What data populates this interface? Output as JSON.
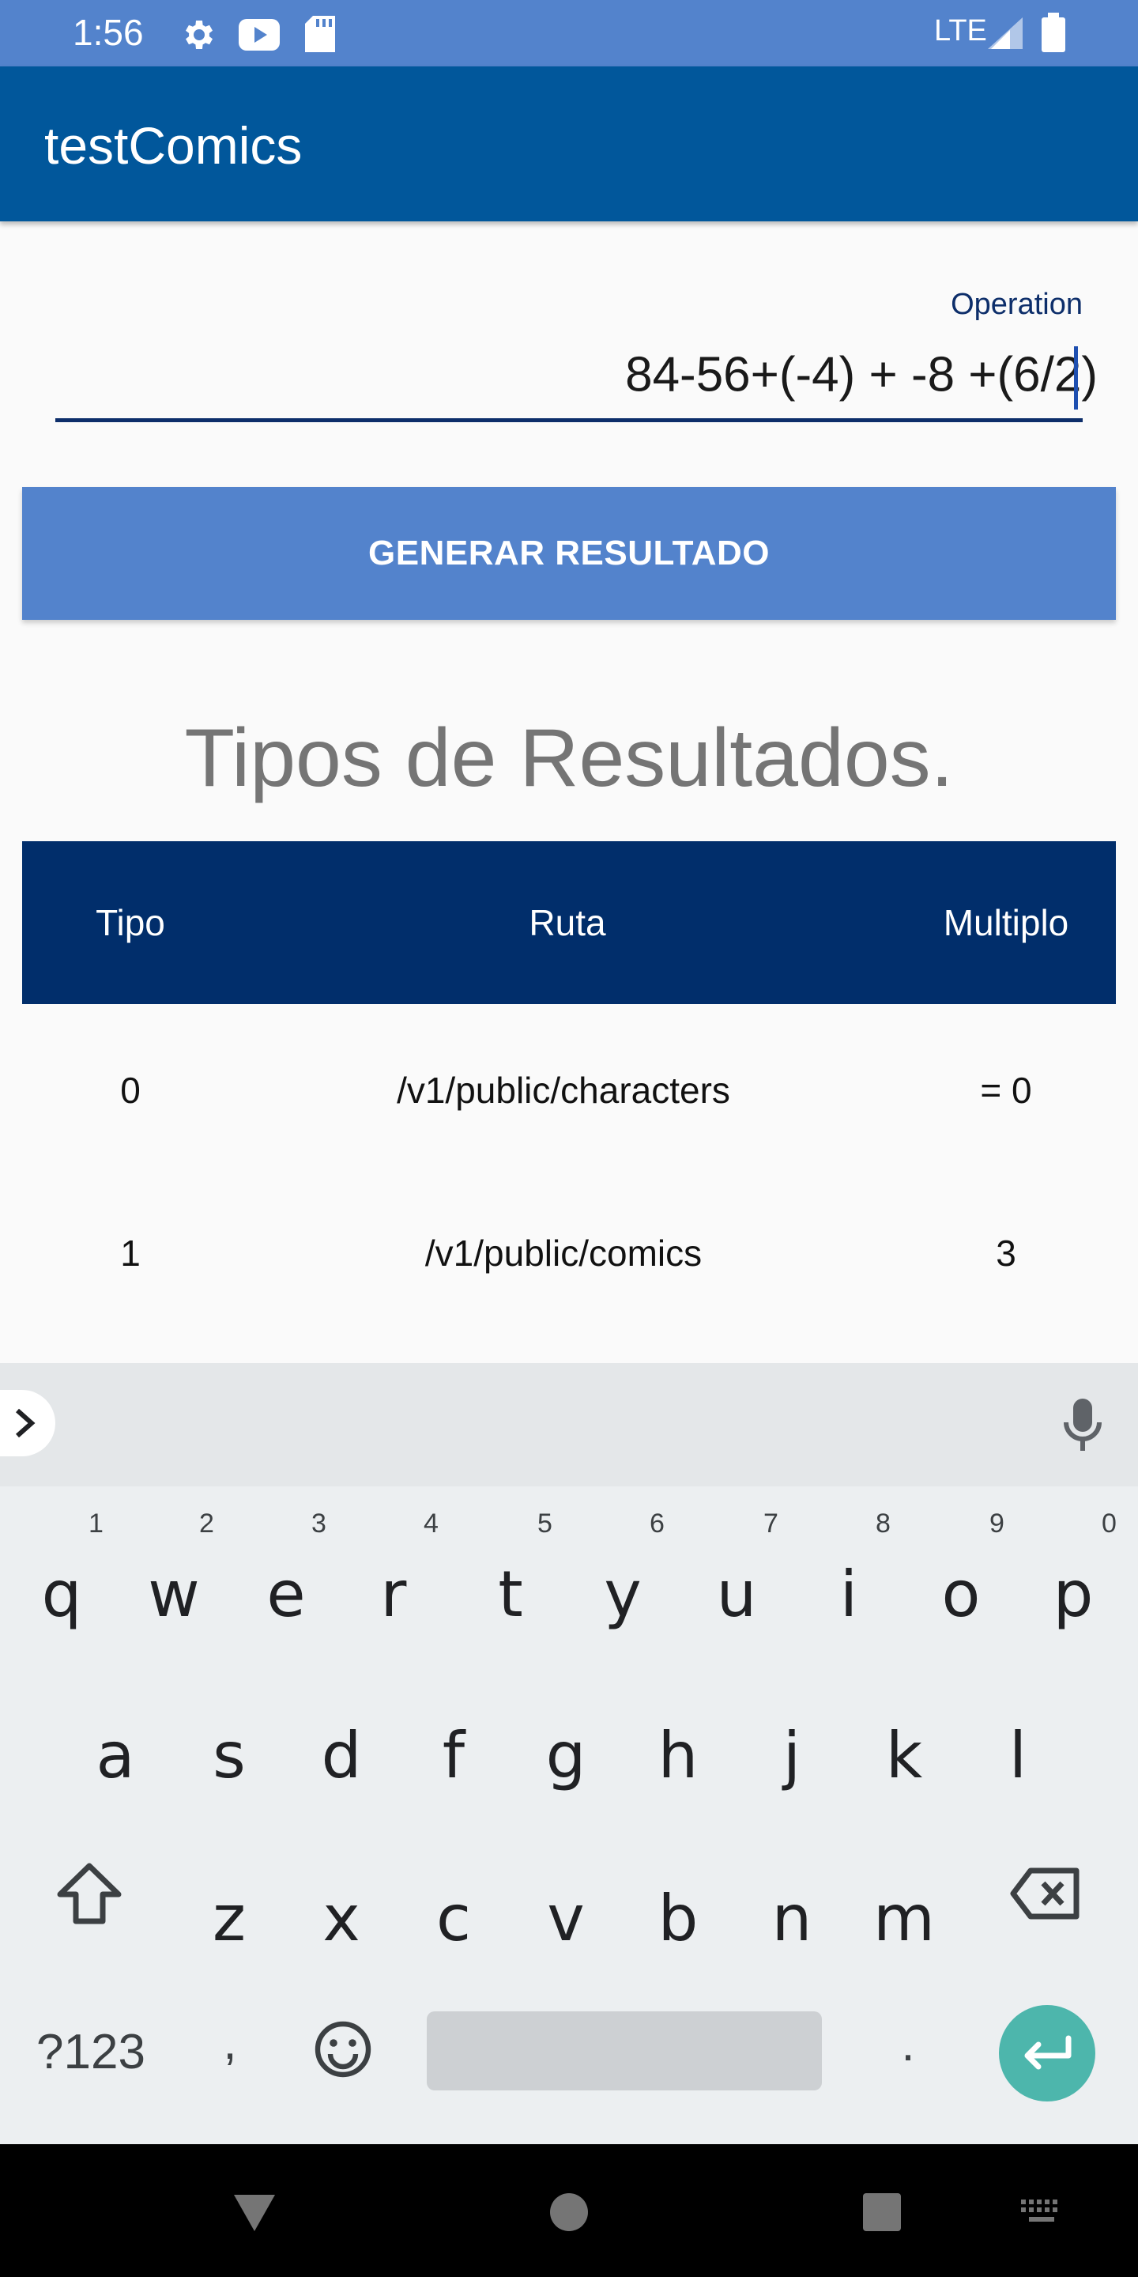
{
  "status_bar": {
    "time": "1:56",
    "network": "LTE",
    "icons": [
      "settings-icon",
      "youtube-icon",
      "sd-card-icon",
      "signal-icon",
      "battery-icon"
    ]
  },
  "app_bar": {
    "title": "testComics"
  },
  "operation_field": {
    "label": "Operation",
    "value": "84-56+(-4) + -8 +(6/2)"
  },
  "generate_button": {
    "label": "GENERAR RESULTADO"
  },
  "results": {
    "heading": "Tipos de Resultados.",
    "columns": [
      "Tipo",
      "Ruta",
      "Multiplo"
    ],
    "rows": [
      [
        "0",
        "/v1/public/characters",
        "= 0"
      ],
      [
        "1",
        "/v1/public/comics",
        "3"
      ]
    ]
  },
  "keyboard": {
    "row1": [
      "q",
      "w",
      "e",
      "r",
      "t",
      "y",
      "u",
      "i",
      "o",
      "p"
    ],
    "row1_hints": [
      "1",
      "2",
      "3",
      "4",
      "5",
      "6",
      "7",
      "8",
      "9",
      "0"
    ],
    "row2": [
      "a",
      "s",
      "d",
      "f",
      "g",
      "h",
      "j",
      "k",
      "l"
    ],
    "row3": [
      "z",
      "x",
      "c",
      "v",
      "b",
      "n",
      "m"
    ],
    "symbols_label": "?123",
    "comma": ",",
    "period": "."
  },
  "colors": {
    "status_bar": "#5383cc",
    "app_bar": "#01579b",
    "button": "#5383cc",
    "table_header": "#012e6b",
    "enter_key": "#4db6ac"
  }
}
